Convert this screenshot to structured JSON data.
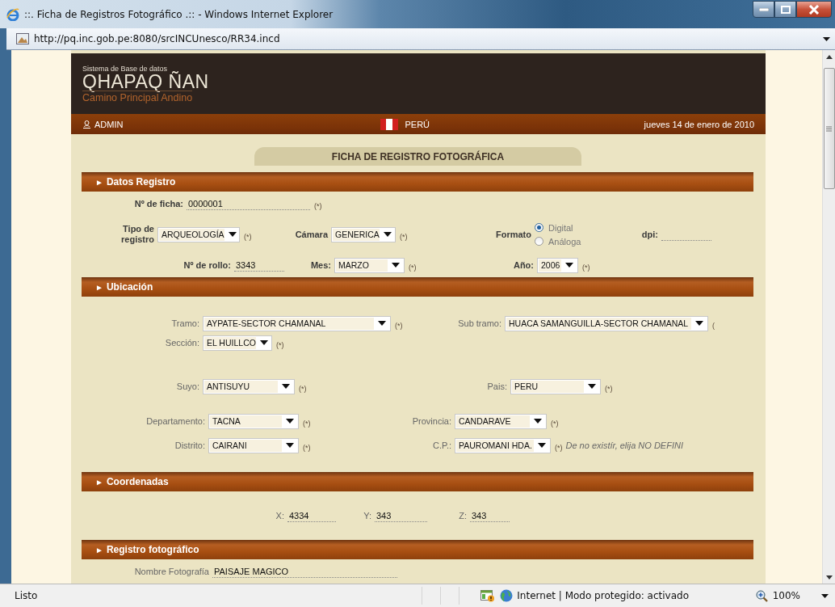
{
  "window": {
    "title": "::. Ficha de Registros Fotográfico .:: - Windows Internet Explorer"
  },
  "address_bar": {
    "url": "http://pq.inc.gob.pe:8080/srcINCUnesco/RR34.incd"
  },
  "header": {
    "subtitle": "Sistema de Base de datos",
    "logo": "QHAPAQ ÑAN",
    "tagline": "Camino Principal Andino"
  },
  "nav": {
    "user": "ADMIN",
    "country": "PERÚ",
    "date": "jueves 14 de enero de 2010"
  },
  "form_title": "FICHA DE REGISTRO FOTOGRÁFICA",
  "sections": [
    {
      "marker": "►",
      "title": "Datos Registro",
      "rows": [
        {
          "fields": [
            {
              "label": "Nº de ficha:",
              "kind": "text",
              "value": "0000001",
              "mark": "(*)"
            }
          ]
        },
        {
          "fields": [
            {
              "label": "Tipo de registro",
              "kind": "select",
              "value": "ARQUEOLOGÍA",
              "mark": "(*)"
            },
            {
              "label": "Cámara",
              "kind": "select",
              "value": "GENERICA",
              "mark": "(*)"
            },
            {
              "label": "Formato",
              "kind": "radio",
              "options": [
                {
                  "label": "Digital",
                  "selected": true
                },
                {
                  "label": "Análoga",
                  "selected": false
                }
              ]
            },
            {
              "label": "dpi:",
              "kind": "text"
            }
          ]
        },
        {
          "fields": [
            {
              "label": "Nº de rollo:",
              "kind": "text",
              "value": "3343"
            },
            {
              "label": "Mes:",
              "kind": "select",
              "value": "MARZO",
              "mark": "(*)"
            },
            {
              "label": "Año:",
              "kind": "select",
              "value": "2006",
              "mark": "(*)"
            }
          ]
        }
      ]
    },
    {
      "marker": "►",
      "title": "Ubicación",
      "rows": [
        {
          "fields": [
            {
              "label": "Tramo:",
              "kind": "select",
              "value": "AYPATE-SECTOR CHAMANAL",
              "mark": "(*)"
            },
            {
              "label": "Sub tramo:",
              "kind": "select",
              "value": "HUACA SAMANGUILLA-SECTOR CHAMANAL",
              "mark": "("
            }
          ]
        },
        {
          "fields": [
            {
              "label": "Sección:",
              "kind": "select",
              "value": "EL HUILLCO",
              "mark": "(*)"
            }
          ]
        },
        {
          "fields": [
            {
              "label": "Suyo:",
              "kind": "select",
              "value": "ANTISUYU",
              "mark": "(*)"
            },
            {
              "label": "Pais:",
              "kind": "select",
              "value": "PERU",
              "mark": "(*)"
            }
          ]
        },
        {
          "fields": [
            {
              "label": "Departamento:",
              "kind": "select",
              "value": "TACNA",
              "mark": "(*)"
            },
            {
              "label": "Provincia:",
              "kind": "select",
              "value": "CANDARAVE",
              "mark": "(*)"
            }
          ]
        },
        {
          "fields": [
            {
              "label": "Distrito:",
              "kind": "select",
              "value": "CAIRANI",
              "mark": "(*)"
            },
            {
              "label": "C.P.:",
              "kind": "select",
              "value": "PAUROMANI HDA.",
              "mark": "(*)",
              "note": "De no existír, elija NO DEFINI"
            }
          ]
        }
      ]
    },
    {
      "marker": "►",
      "title": "Coordenadas",
      "rows": [
        {
          "fields": [
            {
              "label": "X:",
              "kind": "text",
              "value": "4334"
            },
            {
              "label": "Y:",
              "kind": "text",
              "value": "343"
            },
            {
              "label": "Z:",
              "kind": "text",
              "value": "343"
            }
          ]
        }
      ]
    },
    {
      "marker": "►",
      "title": "Registro fotográfico",
      "rows": [
        {
          "fields": [
            {
              "label": "Nombre Fotografía",
              "kind": "text",
              "value": "PAISAJE MAGICO"
            }
          ]
        }
      ]
    }
  ],
  "status_bar": {
    "text": "Listo",
    "zone": "Internet | Modo protegido: activado",
    "zoom": "100%"
  }
}
